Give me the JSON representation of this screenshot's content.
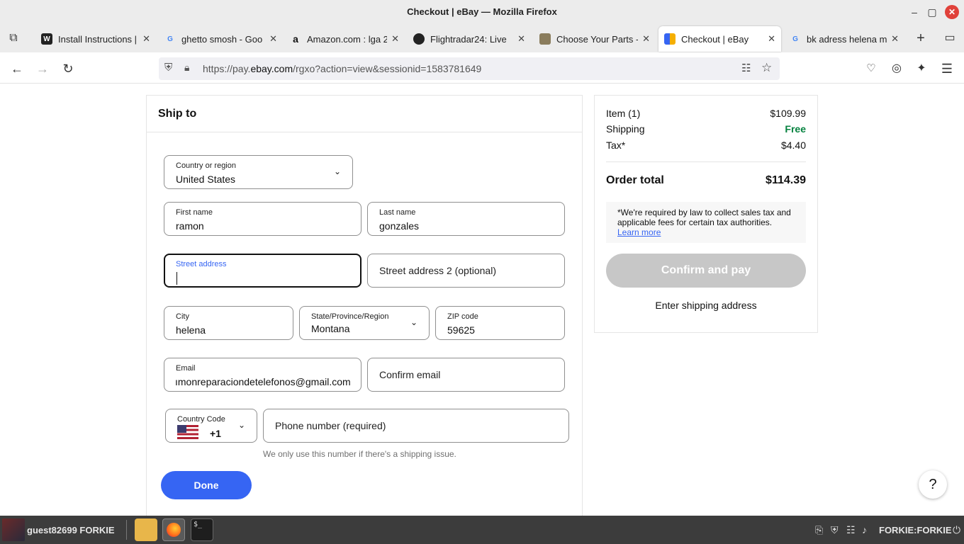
{
  "window": {
    "title": "Checkout | eBay — Mozilla Firefox",
    "minimize_icon": "minimize-icon",
    "maximize_icon": "maximize-icon",
    "close_icon": "close-icon"
  },
  "tabs": [
    {
      "label": "Install Instructions |",
      "favicon": "W",
      "active": false
    },
    {
      "label": "ghetto smosh - Goo",
      "favicon": "G",
      "active": false
    },
    {
      "label": "Amazon.com : lga 2",
      "favicon": "a",
      "active": false
    },
    {
      "label": "Flightradar24: Live",
      "favicon": "radar",
      "active": false
    },
    {
      "label": "Choose Your Parts -",
      "favicon": "box",
      "active": false
    },
    {
      "label": "Checkout | eBay",
      "favicon": "bag",
      "active": true
    },
    {
      "label": "bk adress helena mo",
      "favicon": "G",
      "active": false
    }
  ],
  "navbar": {
    "url_prefix": "https://pay.",
    "url_domain": "ebay.com",
    "url_suffix": "/rgxo?action=view&sessionid=1583781649"
  },
  "ship_to": {
    "heading": "Ship to",
    "country": {
      "label": "Country or region",
      "value": "United States"
    },
    "first_name": {
      "label": "First name",
      "value": "ramon"
    },
    "last_name": {
      "label": "Last name",
      "value": "gonzales"
    },
    "street": {
      "label": "Street address",
      "value": ""
    },
    "street2": {
      "placeholder": "Street address 2 (optional)"
    },
    "city": {
      "label": "City",
      "value": "helena"
    },
    "state": {
      "label": "State/Province/Region",
      "value": "Montana"
    },
    "zip": {
      "label": "ZIP code",
      "value": "59625"
    },
    "email": {
      "label": "Email",
      "value": "ımonreparaciondetelefonos@gmail.com"
    },
    "confirm_email": {
      "placeholder": "Confirm email"
    },
    "country_code": {
      "label": "Country Code",
      "value": "+1"
    },
    "phone": {
      "placeholder": "Phone number (required)"
    },
    "phone_helper": "We only use this number if there's a shipping issue.",
    "done_label": "Done"
  },
  "summary": {
    "item_label": "Item (1)",
    "item_value": "$109.99",
    "shipping_label": "Shipping",
    "shipping_value": "Free",
    "tax_label": "Tax*",
    "tax_value": "$4.40",
    "total_label": "Order total",
    "total_value": "$114.39",
    "tax_note": "*We're required by law to collect sales tax and applicable fees for certain tax authorities.",
    "learn_more": "Learn more",
    "confirm_label": "Confirm and pay",
    "enter_address": "Enter shipping address"
  },
  "help_label": "?",
  "taskbar": {
    "user": "guest82699 FORKIE",
    "host": "FORKIE:FORKIE",
    "term_glyph": "$_"
  },
  "colors": {
    "accent": "#3665f3",
    "free_green": "#05823f",
    "disabled_button": "#c7c7c7"
  }
}
